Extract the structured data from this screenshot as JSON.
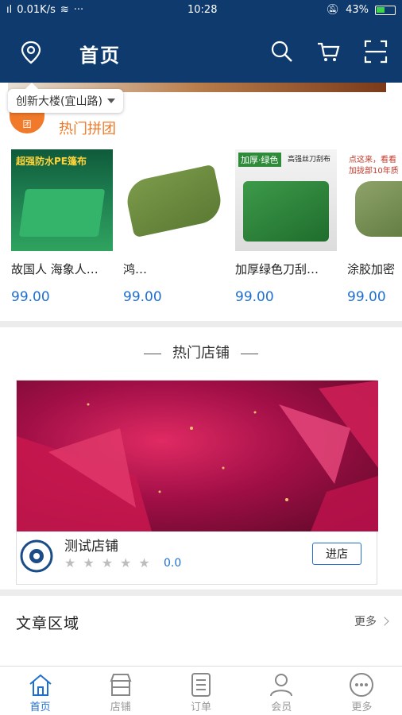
{
  "status": {
    "network": "0.01K/s",
    "dots": "···",
    "time": "10:28",
    "battery": "43%"
  },
  "header": {
    "title": "首页"
  },
  "location_tip": {
    "text": "创新大楼(宜山路)"
  },
  "group_section": {
    "title": "热门拼团"
  },
  "products": [
    {
      "name": "故国人 海象人…",
      "price": "99.00"
    },
    {
      "name": "鸿…",
      "price": "99.00"
    },
    {
      "name": "加厚绿色刀刮…",
      "price": "99.00"
    },
    {
      "name": "涂胶加密",
      "price": "99.00"
    }
  ],
  "product_banners": {
    "p1_heading": "超强防水PE篷布",
    "p3_heading": "加厚·绿色",
    "p3_sub": "高强丝刀刮布",
    "p4_heading": "点这来，看看",
    "p4_sub": "加拢部10年质"
  },
  "shops_section": {
    "title": "热门店铺"
  },
  "shop": {
    "name": "测试店铺",
    "rating": "0.0",
    "stars_filled": 0,
    "stars_total": 5,
    "enter_label": "进店"
  },
  "articles": {
    "title": "文章区域",
    "more": "更多"
  },
  "tabs": [
    {
      "label": "首页",
      "icon": "home-icon",
      "active": true
    },
    {
      "label": "店铺",
      "icon": "store-icon",
      "active": false
    },
    {
      "label": "订单",
      "icon": "order-icon",
      "active": false
    },
    {
      "label": "会员",
      "icon": "member-icon",
      "active": false
    },
    {
      "label": "更多",
      "icon": "more-icon",
      "active": false
    }
  ],
  "colors": {
    "header_bg": "#0e3a6e",
    "accent_orange": "#f07a2a",
    "price_blue": "#1e6fd0"
  }
}
